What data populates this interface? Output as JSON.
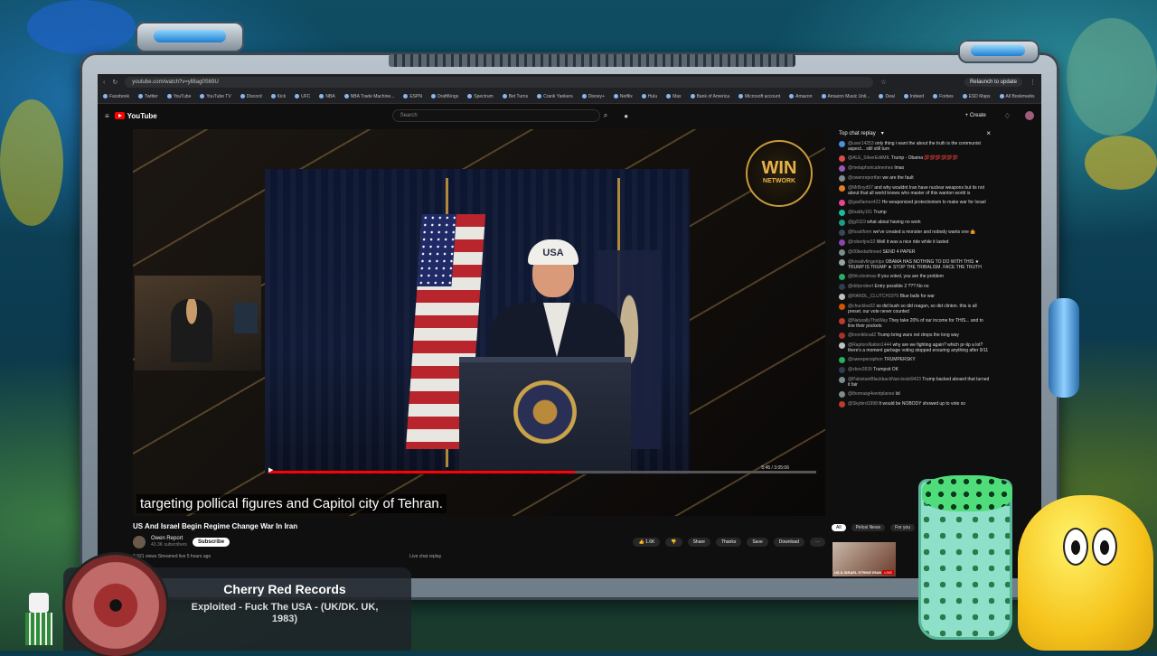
{
  "browser": {
    "url": "youtube.com/watch?v=yll8ag0S69U",
    "relaunch_label": "Relaunch to update",
    "bookmarks": [
      "Facebook",
      "Twitter",
      "YouTube",
      "YouTube TV",
      "Discord",
      "Kick",
      "UFC",
      "NBA",
      "NBA Trade Machine...",
      "ESPN",
      "DraftKings",
      "Spectrum",
      "Bet Turns",
      "Crank Yankers",
      "Disney+",
      "Netflix",
      "Hulu",
      "Max",
      "Bank of America",
      "Microsoft account",
      "Amazon",
      "Amazon Music Unli...",
      "Deal",
      "Indeed",
      "Forbes",
      "ESD Maps",
      "All Bookmarks"
    ]
  },
  "youtube": {
    "logo_label": "YouTube",
    "search_placeholder": "Search",
    "create_label": "Create"
  },
  "player": {
    "watermark_top": "WIN",
    "watermark_bottom": "NETWORK",
    "cap_text": "USA",
    "subtitle": "targeting pollical figures and Capitol city of Tehran.",
    "time": "5:45 / 3:05:06",
    "progress": 0.56
  },
  "video": {
    "title": "US And Israel Begin Regime Change War In Iran",
    "channel": "Owen Report",
    "subscribers": "43.3K subscribers",
    "subscribe_label": "Subscribe",
    "likes": "1.6K",
    "share_label": "Share",
    "thanks_label": "Thanks",
    "save_label": "Save",
    "download_label": "Download",
    "views_line": "3,921 views  Streamed live 5 hours ago",
    "live_chat_label": "Live chat replay"
  },
  "chat": {
    "header": "Top chat replay",
    "messages": [
      {
        "name": "@user14253",
        "text": "only thing i want the about the truth is the communist aspect... still still turn",
        "color": "#4a90e2"
      },
      {
        "name": "@ALE_SilverEditMIL",
        "text": "Trump - Obama 💯💯💯💯💯💯",
        "color": "#e24a4a"
      },
      {
        "name": "@metaphoricalmemes",
        "text": "lmao",
        "color": "#9b59b6"
      },
      {
        "name": "@owenreportfan",
        "text": "we are the fault",
        "color": "#7f8c8d"
      },
      {
        "name": "@MrBoyd97",
        "text": "and why wouldnt Iran have nuclear weapons but its not about that all world knows who master of this wanton world is",
        "color": "#e67e22"
      },
      {
        "name": "@gasflames423",
        "text": "He weaponized protectionism to make war for Israel",
        "color": "#e84393"
      },
      {
        "name": "@buddy101",
        "text": "Trump",
        "color": "#1abc9c"
      },
      {
        "name": "@jg9119",
        "text": "what about having no work",
        "color": "#16a085"
      },
      {
        "name": "@fossilform",
        "text": "we've created a monster and nobody wants one 🤷",
        "color": "#34495e"
      },
      {
        "name": "@robertjoe32",
        "text": "Well it was a nice ride while it lasted",
        "color": "#8e44ad"
      },
      {
        "name": "@00bedarfinned",
        "text": "SEND 4 PAPER",
        "color": "#7f8c8d"
      },
      {
        "name": "@kreativfingertips",
        "text": "OBAMA HAS NOTHING TO DO WITH THIS ★ TRUMP IS TRUMP ★ STOP THE TRIBALISM. FACE THE TRUTH",
        "color": "#95a5a6"
      },
      {
        "name": "@thiccboimax",
        "text": "If you voted, you are the problem",
        "color": "#27ae60"
      },
      {
        "name": "@ddrprobert",
        "text": "Entry possible 2 ??? No no",
        "color": "#2c3e50"
      },
      {
        "name": "@RANDL_CLUTCH1979",
        "text": "Blue balls for war",
        "color": "#bdc3c7"
      },
      {
        "name": "@chuckles02",
        "text": "so did bush so did reagan, so did clinton. this is all preset. our vote never counted",
        "color": "#d35400"
      },
      {
        "name": "@NaturallyThisWay",
        "text": "They take 20% of our income for THIS... and to line their pockets",
        "color": "#c0392b"
      },
      {
        "name": "@kronikbrad2",
        "text": "Trump bring wars not drops the long way",
        "color": "#a93226"
      },
      {
        "name": "@RaptorsNation1444",
        "text": "why are we fighting again? which pr-tip a lot? there's a moment garbage voting stopped ensuring anything after 9/11",
        "color": "#bdc3c7"
      },
      {
        "name": "@sweepersiphon",
        "text": "TRUMPERSKY",
        "color": "#27ae60"
      },
      {
        "name": "@xbox2839",
        "text": "Trumpsit OK",
        "color": "#2c3e50"
      },
      {
        "name": "@PakistaniBlackbackNarcissist9423",
        "text": "Trump backed aboard that turned it fair",
        "color": "#7f8c8d"
      },
      {
        "name": "@thomasg4ventplanes",
        "text": "lol",
        "color": "#7f8c8d"
      },
      {
        "name": "@Skybird1998",
        "text": "It would be NOBODY showed up to vote so",
        "color": "#c0392b"
      }
    ],
    "tabs": [
      "All",
      "Pelosi News",
      "For you"
    ],
    "rec_label": "US & ISRAEL STRIKE IRAN",
    "rec_live": "LIVE"
  },
  "now_playing": {
    "artist": "Cherry Red Records",
    "track": "Exploited - Fuck The USA - (UK/DK. UK, 1983)"
  }
}
